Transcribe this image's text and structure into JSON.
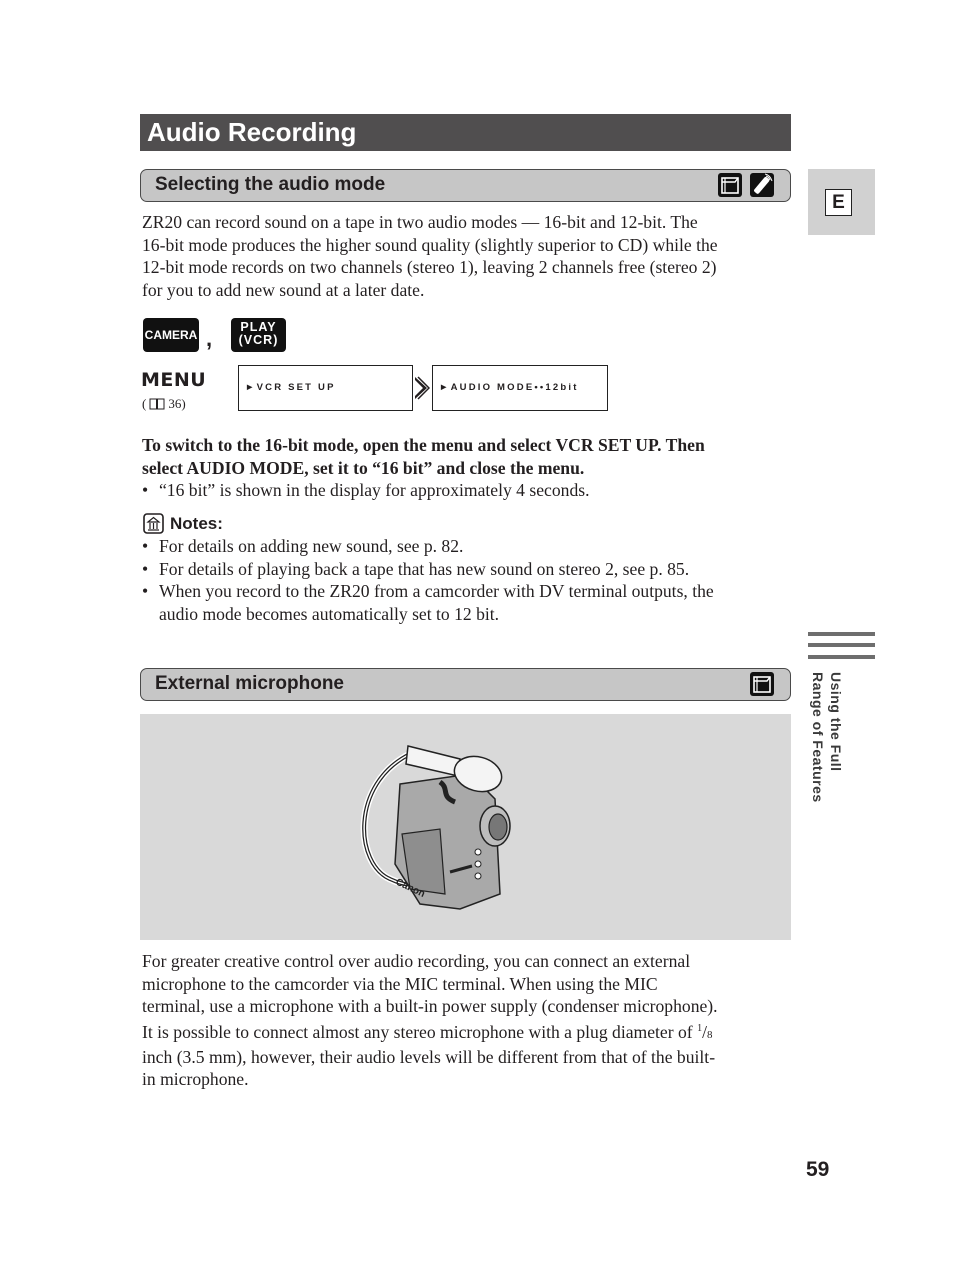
{
  "page": {
    "title": "Audio Recording",
    "language_tab": "E",
    "side_label": [
      "Using the Full",
      "Range of Features"
    ],
    "page_number": "59"
  },
  "section1": {
    "heading": "Selecting the audio mode",
    "icons": [
      "camcorder-mode-icon",
      "remote-control-icon"
    ],
    "intro": [
      "ZR20 can record sound on a tape in two audio modes — 16-bit and 12-bit. The",
      "16-bit mode produces the higher sound quality (slightly superior to CD) while the",
      "12-bit mode records on two channels (stereo 1), leaving 2 channels free (stereo 2)",
      "for you to add new sound at a later date."
    ],
    "keys": {
      "camera": "CAMERA",
      "separator": ",",
      "play_line1": "PLAY",
      "play_line2": "(VCR)"
    },
    "menu": {
      "label": "MENU",
      "reference": "( 🕮 36)",
      "ref_open": "(",
      "ref_page": "36)",
      "screen1": "►VCR SET UP",
      "screen2": "►AUDIO MODE••12bit"
    },
    "instruction": [
      "To switch to the 16-bit mode, open the menu and select VCR SET UP. Then",
      "select AUDIO MODE, set it to “16 bit” and close the menu."
    ],
    "instruction_bullet": "“16 bit” is shown in the display for approximately 4 seconds.",
    "notes_label": "Notes:",
    "notes": [
      [
        "For details on adding new sound, see p. 82."
      ],
      [
        "For details of playing back a tape that has new sound on stereo 2, see p. 85."
      ],
      [
        "When you record to the ZR20 from a camcorder with DV terminal outputs, the",
        "audio mode becomes automatically set to 12 bit."
      ]
    ]
  },
  "section2": {
    "heading": "External microphone",
    "icons": [
      "camcorder-mode-icon"
    ],
    "figure_brand": "Canon",
    "body": [
      "For greater creative control over audio recording, you can connect an external",
      "microphone to the camcorder via the MIC terminal. When using the MIC",
      "terminal, use a microphone with a built-in power supply (condenser microphone).",
      "It is possible to connect almost any stereo microphone with a plug diameter of",
      "inch (3.5 mm), however, their audio levels will be different from that of the built-",
      "in microphone."
    ],
    "fraction_num": "1",
    "fraction_den": "8"
  },
  "bullet_glyph": "•"
}
